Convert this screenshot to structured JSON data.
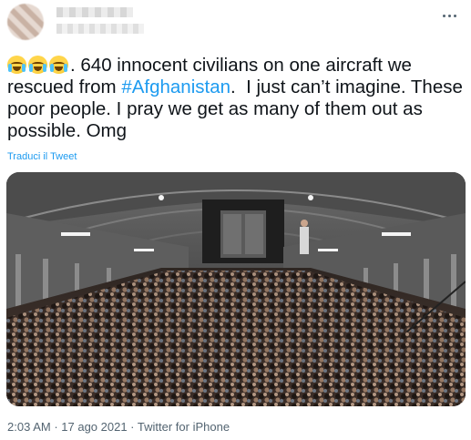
{
  "tweet": {
    "emoji_icons": [
      "loudly-crying-face-emoji",
      "loudly-crying-face-emoji",
      "loudly-crying-face-emoji"
    ],
    "text_part1": ". 640 innocent civilians on one aircraft we rescued from ",
    "hashtag": "#Afghanistan",
    "text_part2": ".  I just can’t imagine. These poor people. I pray we get as many of them out as possible. Omg",
    "translate_link": "Traduci il Tweet",
    "photo_description_icon": "aircraft-cargo-hold-photo"
  },
  "meta": {
    "time": "2:03 AM",
    "separator": " · ",
    "date": "17 ago 2021",
    "source": "Twitter for iPhone"
  },
  "colors": {
    "link": "#1d9bf0",
    "text": "#0f1419",
    "secondary": "#536471"
  }
}
